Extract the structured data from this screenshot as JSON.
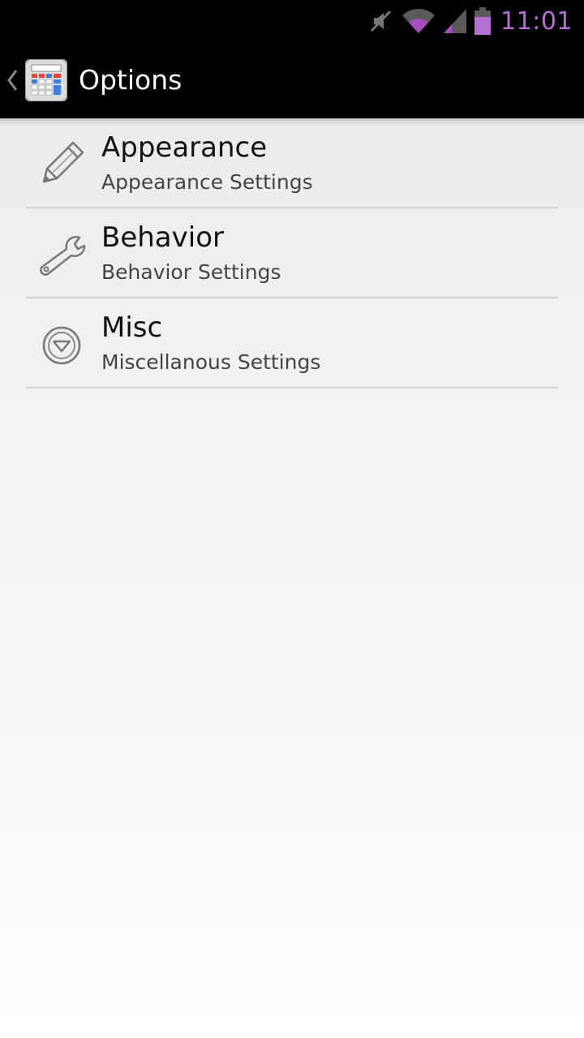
{
  "status_bar": {
    "time": "11:01",
    "icons": [
      "mute-icon",
      "wifi-icon",
      "signal-icon",
      "battery-icon"
    ],
    "accent_color": "#b36fd1"
  },
  "action_bar": {
    "title": "Options",
    "up_icon": "chevron-left-icon",
    "app_icon": "calculator-app-icon"
  },
  "preferences": [
    {
      "title": "Appearance",
      "summary": "Appearance Settings",
      "icon": "pencil-icon"
    },
    {
      "title": "Behavior",
      "summary": "Behavior Settings",
      "icon": "wrench-icon"
    },
    {
      "title": "Misc",
      "summary": "Miscellanous Settings",
      "icon": "circle-down-arrow-icon"
    }
  ]
}
